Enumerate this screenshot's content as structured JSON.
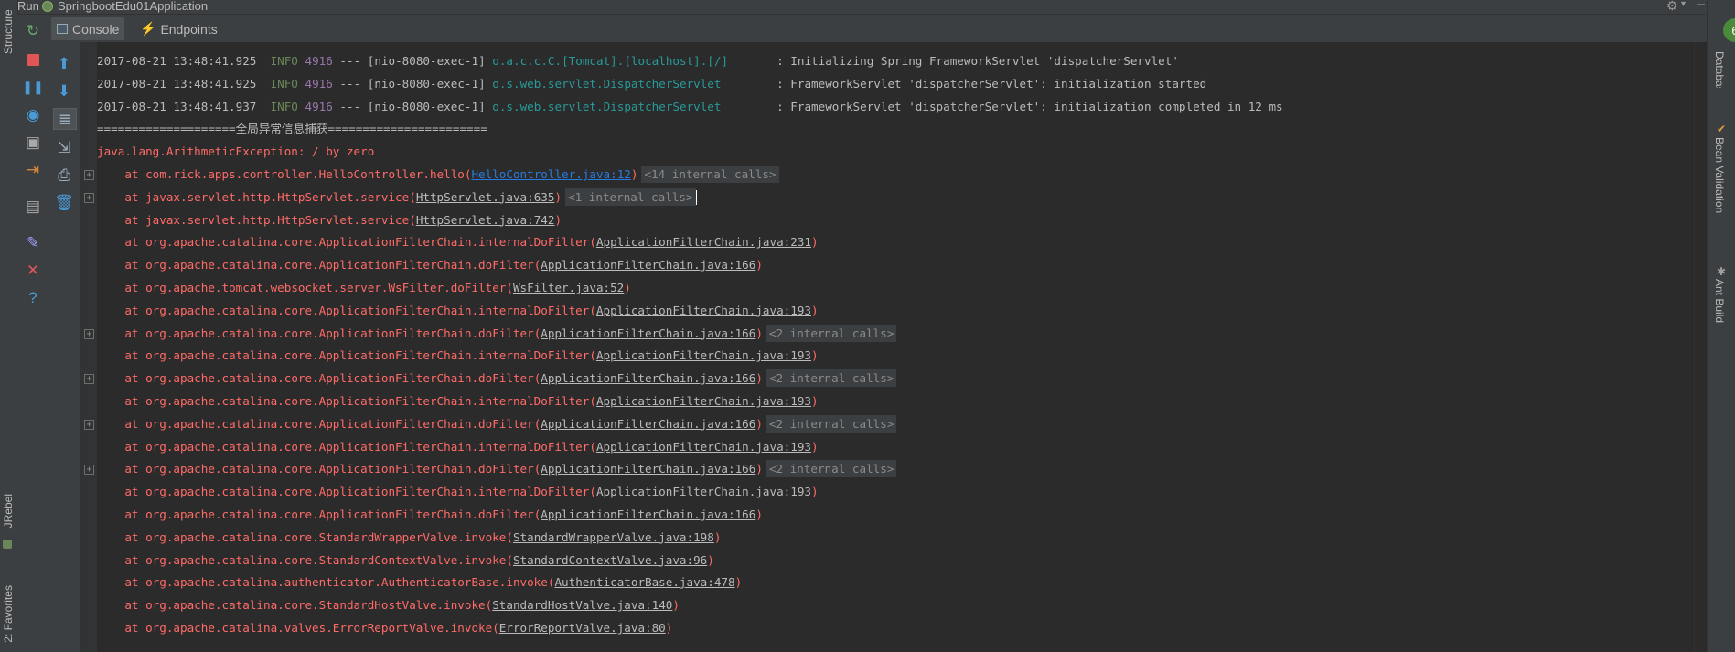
{
  "run_bar": {
    "label": "Run",
    "config": "SpringbootEdu01Application"
  },
  "left_strip": {
    "top_text": "Structure",
    "mid_text": "JRebel",
    "bottom_text": "2: Favorites"
  },
  "tabs": [
    {
      "label": "Console",
      "icon": "console-icon",
      "active": true
    },
    {
      "label": "Endpoints",
      "icon": "endpoints-icon",
      "active": false
    }
  ],
  "right_strip": {
    "badge": "6",
    "items": [
      "Database",
      "Bean Validation",
      "Ant Build"
    ]
  },
  "colors": {
    "background": "#2b2b2b",
    "panel": "#3c3f41",
    "error": "#ff6b68",
    "link": "#287bde",
    "info": "#6a8759",
    "pid": "#9876aa",
    "logger": "#299999"
  },
  "log_lines": [
    {
      "time": "2017-08-21 13:48:41.925",
      "level": "INFO",
      "pid": "4916",
      "sep": " --- ",
      "thread": "[nio-8080-exec-1]",
      "logger": "o.a.c.c.C.[Tomcat].[localhost].[/]      ",
      "message": " : Initializing Spring FrameworkServlet 'dispatcherServlet'"
    },
    {
      "time": "2017-08-21 13:48:41.925",
      "level": "INFO",
      "pid": "4916",
      "sep": " --- ",
      "thread": "[nio-8080-exec-1]",
      "logger": "o.s.web.servlet.DispatcherServlet       ",
      "message": " : FrameworkServlet 'dispatcherServlet': initialization started"
    },
    {
      "time": "2017-08-21 13:48:41.937",
      "level": "INFO",
      "pid": "4916",
      "sep": " --- ",
      "thread": "[nio-8080-exec-1]",
      "logger": "o.s.web.servlet.DispatcherServlet       ",
      "message": " : FrameworkServlet 'dispatcherServlet': initialization completed in 12 ms"
    }
  ],
  "separator_line": "====================全局异常信息捕获=======================",
  "exception_line": "java.lang.ArithmeticException: / by zero",
  "stack_frames": [
    {
      "method": "at com.rick.apps.controller.HelloController.hello",
      "source": "HelloController.java:12",
      "internal": "<14 internal calls>",
      "foldable": true,
      "link_color": true
    },
    {
      "method": "at javax.servlet.http.HttpServlet.service",
      "source": "HttpServlet.java:635",
      "internal": "<1 internal calls>",
      "foldable": true,
      "caret": true
    },
    {
      "method": "at javax.servlet.http.HttpServlet.service",
      "source": "HttpServlet.java:742",
      "internal": "",
      "foldable": false
    },
    {
      "method": "at org.apache.catalina.core.ApplicationFilterChain.internalDoFilter",
      "source": "ApplicationFilterChain.java:231",
      "internal": "",
      "foldable": false
    },
    {
      "method": "at org.apache.catalina.core.ApplicationFilterChain.doFilter",
      "source": "ApplicationFilterChain.java:166",
      "internal": "",
      "foldable": false
    },
    {
      "method": "at org.apache.tomcat.websocket.server.WsFilter.doFilter",
      "source": "WsFilter.java:52",
      "internal": "",
      "foldable": false
    },
    {
      "method": "at org.apache.catalina.core.ApplicationFilterChain.internalDoFilter",
      "source": "ApplicationFilterChain.java:193",
      "internal": "",
      "foldable": false
    },
    {
      "method": "at org.apache.catalina.core.ApplicationFilterChain.doFilter",
      "source": "ApplicationFilterChain.java:166",
      "internal": "<2 internal calls>",
      "foldable": true
    },
    {
      "method": "at org.apache.catalina.core.ApplicationFilterChain.internalDoFilter",
      "source": "ApplicationFilterChain.java:193",
      "internal": "",
      "foldable": false
    },
    {
      "method": "at org.apache.catalina.core.ApplicationFilterChain.doFilter",
      "source": "ApplicationFilterChain.java:166",
      "internal": "<2 internal calls>",
      "foldable": true
    },
    {
      "method": "at org.apache.catalina.core.ApplicationFilterChain.internalDoFilter",
      "source": "ApplicationFilterChain.java:193",
      "internal": "",
      "foldable": false
    },
    {
      "method": "at org.apache.catalina.core.ApplicationFilterChain.doFilter",
      "source": "ApplicationFilterChain.java:166",
      "internal": "<2 internal calls>",
      "foldable": true
    },
    {
      "method": "at org.apache.catalina.core.ApplicationFilterChain.internalDoFilter",
      "source": "ApplicationFilterChain.java:193",
      "internal": "",
      "foldable": false
    },
    {
      "method": "at org.apache.catalina.core.ApplicationFilterChain.doFilter",
      "source": "ApplicationFilterChain.java:166",
      "internal": "<2 internal calls>",
      "foldable": true
    },
    {
      "method": "at org.apache.catalina.core.ApplicationFilterChain.internalDoFilter",
      "source": "ApplicationFilterChain.java:193",
      "internal": "",
      "foldable": false
    },
    {
      "method": "at org.apache.catalina.core.ApplicationFilterChain.doFilter",
      "source": "ApplicationFilterChain.java:166",
      "internal": "",
      "foldable": false
    },
    {
      "method": "at org.apache.catalina.core.StandardWrapperValve.invoke",
      "source": "StandardWrapperValve.java:198",
      "internal": "",
      "foldable": false
    },
    {
      "method": "at org.apache.catalina.core.StandardContextValve.invoke",
      "source": "StandardContextValve.java:96",
      "internal": "",
      "foldable": false
    },
    {
      "method": "at org.apache.catalina.authenticator.AuthenticatorBase.invoke",
      "source": "AuthenticatorBase.java:478",
      "internal": "",
      "foldable": false
    },
    {
      "method": "at org.apache.catalina.core.StandardHostValve.invoke",
      "source": "StandardHostValve.java:140",
      "internal": "",
      "foldable": false
    },
    {
      "method": "at org.apache.catalina.valves.ErrorReportValve.invoke",
      "source": "ErrorReportValve.java:80",
      "internal": "",
      "foldable": false
    }
  ]
}
